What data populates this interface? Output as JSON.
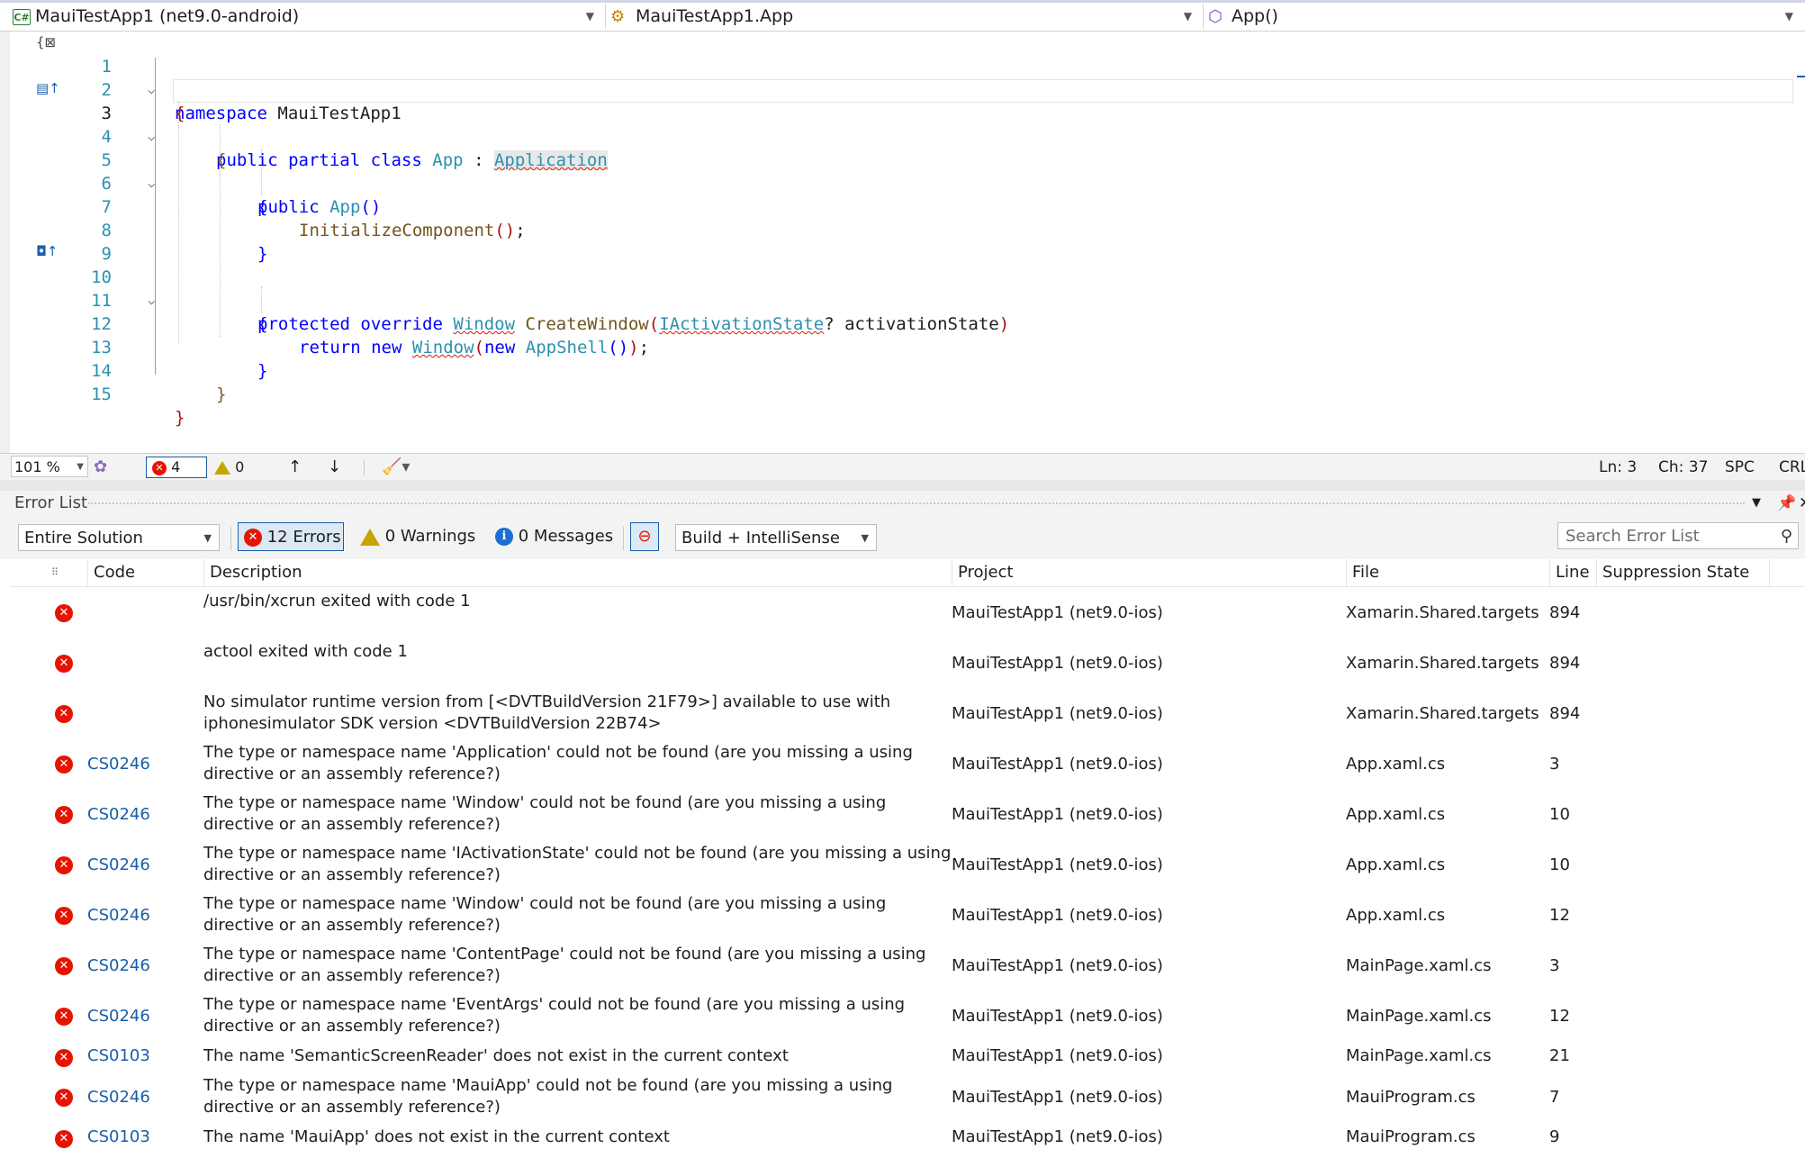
{
  "navbar": {
    "project": "MauiTestApp1 (net9.0-android)",
    "type": "MauiTestApp1.App",
    "member": "App()"
  },
  "editor": {
    "lines": [
      {
        "n": "1",
        "text": "namespace MauiTestApp1"
      },
      {
        "n": "2",
        "text": "{"
      },
      {
        "n": "3",
        "text": "public partial class App : Application"
      },
      {
        "n": "4",
        "text": "{"
      },
      {
        "n": "5",
        "text": "public App()"
      },
      {
        "n": "6",
        "text": "{"
      },
      {
        "n": "7",
        "text": "InitializeComponent();"
      },
      {
        "n": "8",
        "text": "}"
      },
      {
        "n": "9",
        "text": ""
      },
      {
        "n": "10",
        "text": "protected override Window CreateWindow(IActivationState? activationState)"
      },
      {
        "n": "11",
        "text": "{"
      },
      {
        "n": "12",
        "text": "return new Window(new AppShell());"
      },
      {
        "n": "13",
        "text": "}"
      },
      {
        "n": "14",
        "text": "}"
      },
      {
        "n": "15",
        "text": "}"
      }
    ],
    "tokens": {
      "namespace_kw": "namespace",
      "namespace_name": "MauiTestApp1",
      "public": "public",
      "partial": "partial",
      "class": "class",
      "app": "App",
      "colon": ":",
      "application": "Application",
      "app_ctor": "App",
      "parens": "()",
      "init": "InitializeComponent",
      "init_parens": "()",
      "semi": ";",
      "protected": "protected",
      "override": "override",
      "window": "Window",
      "createwindow": "CreateWindow",
      "open_paren": "(",
      "iactivation": "IActivationState",
      "param": "? activationState",
      "close_paren": ")",
      "return": "return",
      "new": "new",
      "window2": "Window",
      "new2": "new",
      "appshell": "AppShell",
      "appshell_parens": "()",
      "close_paren2": ")",
      "semi2": ";"
    },
    "status": {
      "zoom": "101 %",
      "errors": "4",
      "warnings": "0",
      "ln": "Ln: 3",
      "ch": "Ch: 37",
      "spc": "SPC",
      "crlf": "CRLF"
    }
  },
  "error_list": {
    "title": "Error List",
    "scope": "Entire Solution",
    "errors_label": "12 Errors",
    "warnings_label": "0 Warnings",
    "messages_label": "0 Messages",
    "build_filter": "Build + IntelliSense",
    "search_placeholder": "Search Error List",
    "columns": {
      "code": "Code",
      "description": "Description",
      "project": "Project",
      "file": "File",
      "line": "Line",
      "suppression": "Suppression State"
    },
    "rows": [
      {
        "code": "",
        "description": "/usr/bin/xcrun exited with code 1",
        "project": "MauiTestApp1 (net9.0-ios)",
        "file": "Xamarin.Shared.targets",
        "line": "894"
      },
      {
        "code": "",
        "description": "actool exited with code 1",
        "project": "MauiTestApp1 (net9.0-ios)",
        "file": "Xamarin.Shared.targets",
        "line": "894"
      },
      {
        "code": "",
        "description": "No simulator runtime version from [<DVTBuildVersion 21F79>] available to use with iphonesimulator SDK version <DVTBuildVersion 22B74>",
        "project": "MauiTestApp1 (net9.0-ios)",
        "file": "Xamarin.Shared.targets",
        "line": "894"
      },
      {
        "code": "CS0246",
        "description": "The type or namespace name 'Application' could not be found (are you missing a using directive or an assembly reference?)",
        "project": "MauiTestApp1 (net9.0-ios)",
        "file": "App.xaml.cs",
        "line": "3"
      },
      {
        "code": "CS0246",
        "description": "The type or namespace name 'Window' could not be found (are you missing a using directive or an assembly reference?)",
        "project": "MauiTestApp1 (net9.0-ios)",
        "file": "App.xaml.cs",
        "line": "10"
      },
      {
        "code": "CS0246",
        "description": "The type or namespace name 'IActivationState' could not be found (are you missing a using directive or an assembly reference?)",
        "project": "MauiTestApp1 (net9.0-ios)",
        "file": "App.xaml.cs",
        "line": "10"
      },
      {
        "code": "CS0246",
        "description": "The type or namespace name 'Window' could not be found (are you missing a using directive or an assembly reference?)",
        "project": "MauiTestApp1 (net9.0-ios)",
        "file": "App.xaml.cs",
        "line": "12"
      },
      {
        "code": "CS0246",
        "description": "The type or namespace name 'ContentPage' could not be found (are you missing a using directive or an assembly reference?)",
        "project": "MauiTestApp1 (net9.0-ios)",
        "file": "MainPage.xaml.cs",
        "line": "3"
      },
      {
        "code": "CS0246",
        "description": "The type or namespace name 'EventArgs' could not be found (are you missing a using directive or an assembly reference?)",
        "project": "MauiTestApp1 (net9.0-ios)",
        "file": "MainPage.xaml.cs",
        "line": "12"
      },
      {
        "code": "CS0103",
        "description": "The name 'SemanticScreenReader' does not exist in the current context",
        "project": "MauiTestApp1 (net9.0-ios)",
        "file": "MainPage.xaml.cs",
        "line": "21"
      },
      {
        "code": "CS0246",
        "description": "The type or namespace name 'MauiApp' could not be found (are you missing a using directive or an assembly reference?)",
        "project": "MauiTestApp1 (net9.0-ios)",
        "file": "MauiProgram.cs",
        "line": "7"
      },
      {
        "code": "CS0103",
        "description": "The name 'MauiApp' does not exist in the current context",
        "project": "MauiTestApp1 (net9.0-ios)",
        "file": "MauiProgram.cs",
        "line": "9"
      }
    ]
  }
}
